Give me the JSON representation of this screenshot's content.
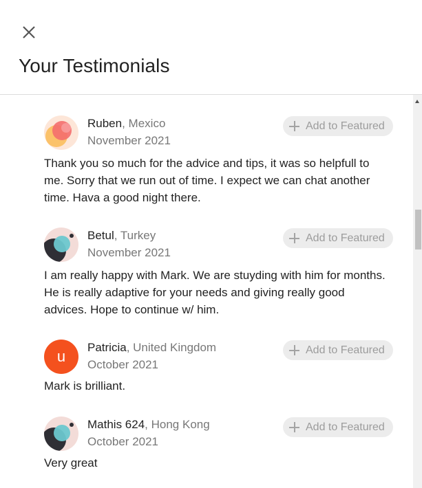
{
  "header": {
    "title": "Your Testimonials",
    "close_icon": "close-icon"
  },
  "testimonials": [
    {
      "name": "Ruben",
      "country": ", Mexico",
      "date": "November 2021",
      "button": "Add to Featured",
      "text": "Thank you so much for the advice and tips, it was so helpfull to me. Sorry that we run out of time. I expect we can chat another time. Hava a good night there.",
      "avatar": "abstract-pink-circles"
    },
    {
      "name": "Betul",
      "country": ", Turkey",
      "date": "November 2021",
      "button": "Add to Featured",
      "text": "I am really happy with Mark. We are stuyding with him for months. He is really adaptive for your needs and giving really good advices. Hope to continue w/ him.",
      "avatar": "abstract-teal-dark"
    },
    {
      "name": "Patricia",
      "country": ", United Kingdom",
      "date": "October 2021",
      "button": "Add to Featured",
      "text": "Mark is brilliant.",
      "avatar_letter": "u",
      "avatar_color": "#f4511e"
    },
    {
      "name": "Mathis 624",
      "country": ", Hong Kong",
      "date": "October 2021",
      "button": "Add to Featured",
      "text": "Very great",
      "avatar": "abstract-teal-dark"
    }
  ]
}
